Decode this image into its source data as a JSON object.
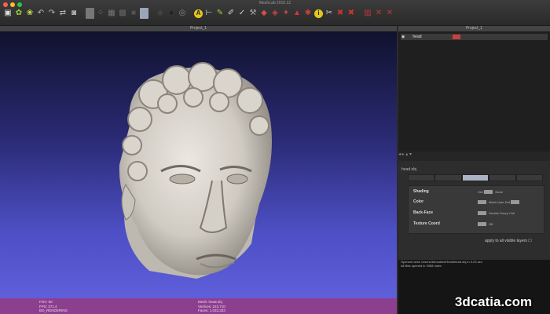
{
  "app": {
    "title": "MeshLab 2016.12",
    "window_dot_colors": [
      "#ff5f57",
      "#febc2e",
      "#28c840"
    ]
  },
  "toolbar": {
    "icons": [
      {
        "name": "new-project-icon",
        "glyph": "▣",
        "color": "#dddddd"
      },
      {
        "name": "open-icon",
        "glyph": "✿",
        "color": "#9bd23c"
      },
      {
        "name": "import-mesh-icon",
        "glyph": "❀",
        "color": "#c5e04a"
      },
      {
        "name": "reload-icon",
        "glyph": "↶",
        "color": "#bbbbbb"
      },
      {
        "name": "export-icon",
        "glyph": "↷",
        "color": "#bbbbbb"
      },
      {
        "name": "save-snapshot-icon",
        "glyph": "⇄",
        "color": "#bbbbbb"
      },
      {
        "name": "camera-icon",
        "glyph": "◙",
        "color": "#bbbbbb"
      },
      {
        "name": "sep",
        "glyph": "",
        "color": ""
      },
      {
        "name": "bbox-render-icon",
        "glyph": "box",
        "color": ""
      },
      {
        "name": "points-render-icon",
        "glyph": "⁘",
        "color": "#999999"
      },
      {
        "name": "wireframe-render-icon",
        "glyph": "▦",
        "color": "#777777"
      },
      {
        "name": "flat-render-icon",
        "glyph": "▩",
        "color": "#666666"
      },
      {
        "name": "smooth-render-icon",
        "glyph": "■",
        "color": "#555555"
      },
      {
        "name": "texture-render-icon",
        "glyph": "box2",
        "color": ""
      },
      {
        "name": "sep",
        "glyph": "",
        "color": ""
      },
      {
        "name": "light-icon",
        "glyph": "◉",
        "color": "#444444"
      },
      {
        "name": "sphere-icon",
        "glyph": "●",
        "color": "#222222"
      },
      {
        "name": "color-icon",
        "glyph": "◎",
        "color": "#888888"
      },
      {
        "name": "sep",
        "glyph": "",
        "color": ""
      },
      {
        "name": "annotation-tool-icon",
        "glyph": "A",
        "color": "circle"
      },
      {
        "name": "measure-tool-icon",
        "glyph": "⊢",
        "color": "#dddddd"
      },
      {
        "name": "paint-tool-icon",
        "glyph": "✎",
        "color": "#9bd23c"
      },
      {
        "name": "brush-tool-icon",
        "glyph": "✐",
        "color": "#cccccc"
      },
      {
        "name": "pick-points-icon",
        "glyph": "✓",
        "color": "#cccccc"
      },
      {
        "name": "align-tool-icon",
        "glyph": "⚒",
        "color": "#aaaaaa"
      },
      {
        "name": "raster-tool-icon",
        "glyph": "◆",
        "color": "#d44b4b"
      },
      {
        "name": "select-faces-icon",
        "glyph": "◈",
        "color": "#cc4444"
      },
      {
        "name": "select-vertices-icon",
        "glyph": "✦",
        "color": "#c84848"
      },
      {
        "name": "select-connected-icon",
        "glyph": "▲",
        "color": "#cc3a3a"
      },
      {
        "name": "fill-hole-icon",
        "glyph": "✱",
        "color": "#c6403f"
      },
      {
        "name": "info-icon",
        "glyph": "i",
        "color": "circle"
      },
      {
        "name": "transform-icon",
        "glyph": "✂",
        "color": "#cccccc"
      },
      {
        "name": "delete-faces-icon",
        "glyph": "✖",
        "color": "#cc3333"
      },
      {
        "name": "delete-vertices-icon",
        "glyph": "✖",
        "color": "#cc3333"
      },
      {
        "name": "sep",
        "glyph": "",
        "color": ""
      },
      {
        "name": "delete-selected-faces-icon",
        "glyph": "▥",
        "color": "#c43838"
      },
      {
        "name": "delete-selected-vertices-icon",
        "glyph": "✕",
        "color": "#c43838"
      },
      {
        "name": "delete-all-icon",
        "glyph": "✕",
        "color": "#c43838"
      }
    ]
  },
  "viewport": {
    "title": "Project_1",
    "status_left": [
      "FOV: 60",
      "FPS: 371.4",
      "BO_RENDERING"
    ],
    "status_right": [
      "Mesh: head.obj",
      "Vertices: 223,710",
      "Faces: 1,033,333"
    ]
  },
  "layers_panel": {
    "title": "Project_1",
    "layer_name": "head",
    "eye_glyph": "◉",
    "footer_glyphs": "◂ ▸ ▴ ▾"
  },
  "properties": {
    "title": "head.obj",
    "tabs": [
      "",
      "",
      "",
      "",
      ""
    ],
    "rows": {
      "shading": {
        "label": "Shading",
        "opts": [
          "Vert",
          "Face",
          "None"
        ]
      },
      "color": {
        "label": "Color",
        "opts": [
          "Mesh",
          "User-Def"
        ]
      },
      "backface": {
        "label": "Back-Face",
        "opts": [
          "Single",
          "Double",
          "Fancy",
          "Cull"
        ]
      },
      "texcoord": {
        "label": "Texture Coord",
        "opts": [
          "Off"
        ]
      }
    },
    "apply_label": "apply to all visible layers ☐"
  },
  "log": {
    "lines": [
      "Opened mesh /Users/3dmodels/Head/head.obj in 3.23 sec",
      "All files opened in 3308 msec"
    ]
  },
  "watermark": "3dcatia.com"
}
